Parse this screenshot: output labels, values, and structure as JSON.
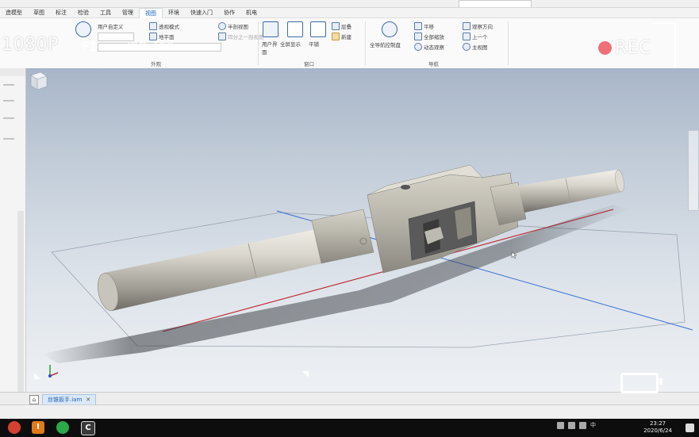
{
  "overlay": {
    "resolution": "1080P",
    "iso": "ISO 400",
    "f_label": "F1",
    "rec": "REC"
  },
  "tabs": [
    "造模型",
    "草图",
    "标注",
    "检验",
    "工具",
    "管理",
    "视图",
    "环境",
    "快速入门",
    "协作",
    "机电"
  ],
  "active_tab": "视图",
  "ribbon": {
    "items": {
      "user_defined": "用户自定义",
      "perspective": "透视模式",
      "ground_plane": "地平面",
      "half_section": "半剖视图",
      "quarter_section": "四分之一剖视图",
      "full_screen": "全屏显示",
      "tile": "平铺",
      "cascade": "层叠",
      "new": "新建",
      "user_interface": "用户界面",
      "steering_wheel": "全导航控制盘",
      "pan": "平移",
      "zoom_all": "全部缩放",
      "orbit": "动态观察",
      "view_face": "观察方向",
      "previous": "上一个",
      "home_view": "主视图"
    },
    "groups": {
      "appearance": "外观",
      "windows": "窗口",
      "navigate": "导航"
    }
  },
  "document_tab": "丝锥扳手.iam",
  "taskbar": {
    "time": "23:27",
    "date": "2020/6/24",
    "ime": "中"
  },
  "colors": {
    "accent": "#1a5fb4",
    "rec_dot": "#f07078"
  }
}
